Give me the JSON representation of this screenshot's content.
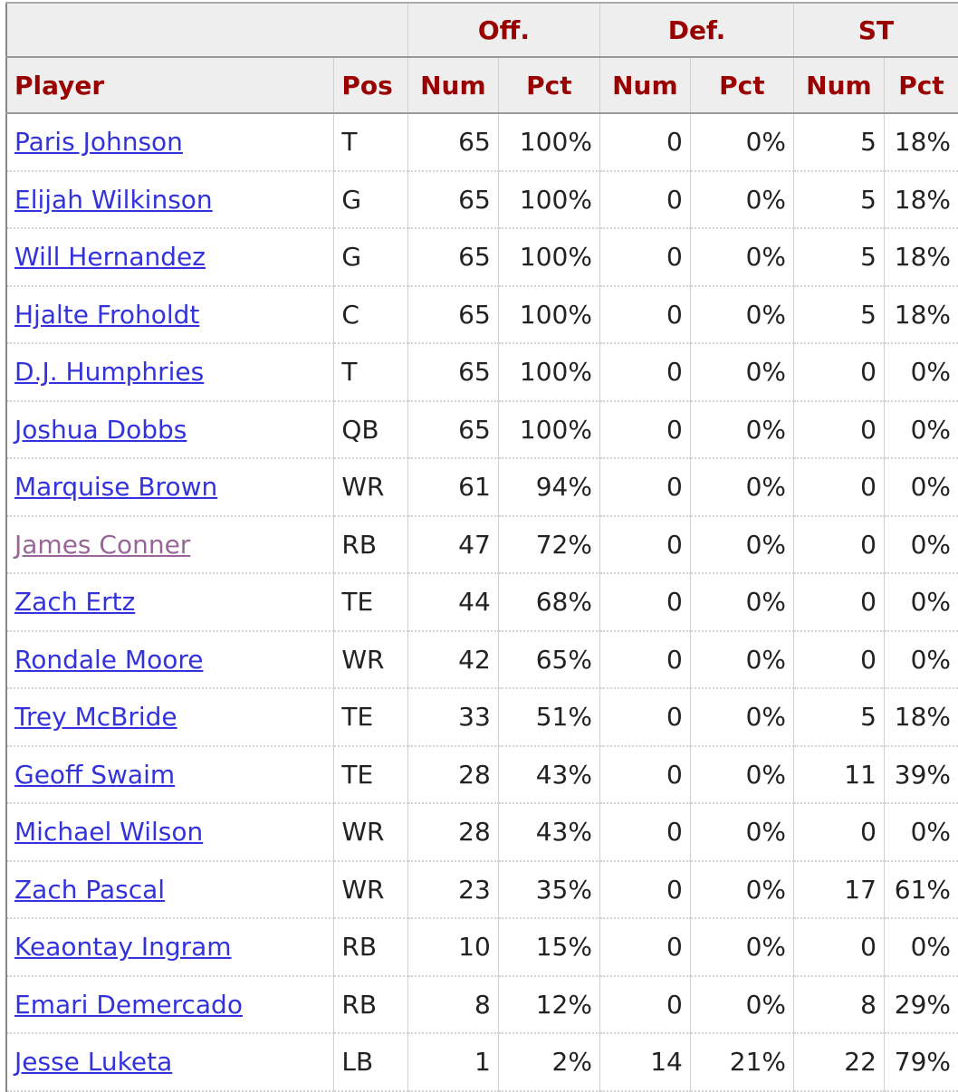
{
  "colors": {
    "header_text": "#990000",
    "header_bg": "#eeeeee",
    "link": "#3333dd",
    "visited_link": "#996699"
  },
  "header": {
    "groups": [
      "Off.",
      "Def.",
      "ST"
    ],
    "columns": [
      "Player",
      "Pos",
      "Num",
      "Pct",
      "Num",
      "Pct",
      "Num",
      "Pct"
    ]
  },
  "rows": [
    {
      "player": "Paris Johnson",
      "pos": "T",
      "off_num": "65",
      "off_pct": "100%",
      "def_num": "0",
      "def_pct": "0%",
      "st_num": "5",
      "st_pct": "18%"
    },
    {
      "player": "Elijah Wilkinson",
      "pos": "G",
      "off_num": "65",
      "off_pct": "100%",
      "def_num": "0",
      "def_pct": "0%",
      "st_num": "5",
      "st_pct": "18%"
    },
    {
      "player": "Will Hernandez",
      "pos": "G",
      "off_num": "65",
      "off_pct": "100%",
      "def_num": "0",
      "def_pct": "0%",
      "st_num": "5",
      "st_pct": "18%"
    },
    {
      "player": "Hjalte Froholdt",
      "pos": "C",
      "off_num": "65",
      "off_pct": "100%",
      "def_num": "0",
      "def_pct": "0%",
      "st_num": "5",
      "st_pct": "18%"
    },
    {
      "player": "D.J. Humphries",
      "pos": "T",
      "off_num": "65",
      "off_pct": "100%",
      "def_num": "0",
      "def_pct": "0%",
      "st_num": "0",
      "st_pct": "0%"
    },
    {
      "player": "Joshua Dobbs",
      "pos": "QB",
      "off_num": "65",
      "off_pct": "100%",
      "def_num": "0",
      "def_pct": "0%",
      "st_num": "0",
      "st_pct": "0%"
    },
    {
      "player": "Marquise Brown",
      "pos": "WR",
      "off_num": "61",
      "off_pct": "94%",
      "def_num": "0",
      "def_pct": "0%",
      "st_num": "0",
      "st_pct": "0%"
    },
    {
      "player": "James Conner",
      "pos": "RB",
      "off_num": "47",
      "off_pct": "72%",
      "def_num": "0",
      "def_pct": "0%",
      "st_num": "0",
      "st_pct": "0%",
      "visited": true
    },
    {
      "player": "Zach Ertz",
      "pos": "TE",
      "off_num": "44",
      "off_pct": "68%",
      "def_num": "0",
      "def_pct": "0%",
      "st_num": "0",
      "st_pct": "0%"
    },
    {
      "player": "Rondale Moore",
      "pos": "WR",
      "off_num": "42",
      "off_pct": "65%",
      "def_num": "0",
      "def_pct": "0%",
      "st_num": "0",
      "st_pct": "0%"
    },
    {
      "player": "Trey McBride",
      "pos": "TE",
      "off_num": "33",
      "off_pct": "51%",
      "def_num": "0",
      "def_pct": "0%",
      "st_num": "5",
      "st_pct": "18%"
    },
    {
      "player": "Geoff Swaim",
      "pos": "TE",
      "off_num": "28",
      "off_pct": "43%",
      "def_num": "0",
      "def_pct": "0%",
      "st_num": "11",
      "st_pct": "39%"
    },
    {
      "player": "Michael Wilson",
      "pos": "WR",
      "off_num": "28",
      "off_pct": "43%",
      "def_num": "0",
      "def_pct": "0%",
      "st_num": "0",
      "st_pct": "0%"
    },
    {
      "player": "Zach Pascal",
      "pos": "WR",
      "off_num": "23",
      "off_pct": "35%",
      "def_num": "0",
      "def_pct": "0%",
      "st_num": "17",
      "st_pct": "61%"
    },
    {
      "player": "Keaontay Ingram",
      "pos": "RB",
      "off_num": "10",
      "off_pct": "15%",
      "def_num": "0",
      "def_pct": "0%",
      "st_num": "0",
      "st_pct": "0%"
    },
    {
      "player": "Emari Demercado",
      "pos": "RB",
      "off_num": "8",
      "off_pct": "12%",
      "def_num": "0",
      "def_pct": "0%",
      "st_num": "8",
      "st_pct": "29%"
    },
    {
      "player": "Jesse Luketa",
      "pos": "LB",
      "off_num": "1",
      "off_pct": "2%",
      "def_num": "14",
      "def_pct": "21%",
      "st_num": "22",
      "st_pct": "79%"
    }
  ]
}
